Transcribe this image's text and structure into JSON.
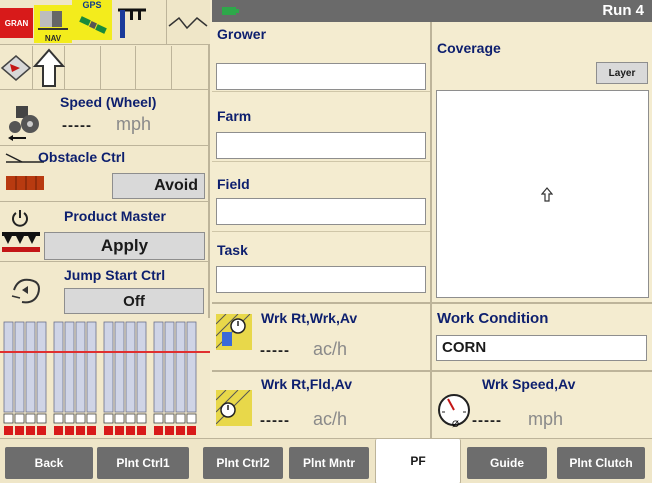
{
  "status_bar": {
    "gran_label": "GRAN",
    "nav_label": "NAV",
    "gps_label": "GPS"
  },
  "left": {
    "speed": {
      "label": "Speed (Wheel)",
      "value": "-----",
      "unit": "mph"
    },
    "obstacle": {
      "label": "Obstacle Ctrl",
      "button": "Avoid"
    },
    "product_master": {
      "label": "Product Master",
      "button": "Apply"
    },
    "jump_start": {
      "label": "Jump Start Ctrl",
      "button": "Off"
    }
  },
  "header": {
    "run_label": "Run 4"
  },
  "job": {
    "grower_label": "Grower",
    "grower_value": "",
    "farm_label": "Farm",
    "farm_value": "",
    "field_label": "Field",
    "field_value": "",
    "task_label": "Task",
    "task_value": ""
  },
  "coverage": {
    "label": "Coverage",
    "layer_button": "Layer"
  },
  "metrics": {
    "work_rate_work": {
      "label": "Wrk Rt,Wrk,Av",
      "value": "-----",
      "unit": "ac/h"
    },
    "work_rate_field": {
      "label": "Wrk Rt,Fld,Av",
      "value": "-----",
      "unit": "ac/h"
    },
    "work_condition": {
      "label": "Work Condition",
      "value": "CORN"
    },
    "work_speed": {
      "label": "Wrk Speed,Av",
      "value": "-----",
      "unit": "mph"
    }
  },
  "tabs": [
    {
      "label": "Back"
    },
    {
      "label": "Plnt Ctrl1"
    },
    {
      "label": "Plnt Ctrl2"
    },
    {
      "label": "Plnt Mntr"
    },
    {
      "label": "PF"
    },
    {
      "label": "Guide"
    },
    {
      "label": "Plnt Clutch"
    }
  ],
  "colors": {
    "panel": "#f4ecd0",
    "label_blue": "#0d1f6e",
    "tab_gray": "#6d6d6d",
    "alert_red": "#d81a1a",
    "indicator_yellow": "#f3ec1c"
  }
}
